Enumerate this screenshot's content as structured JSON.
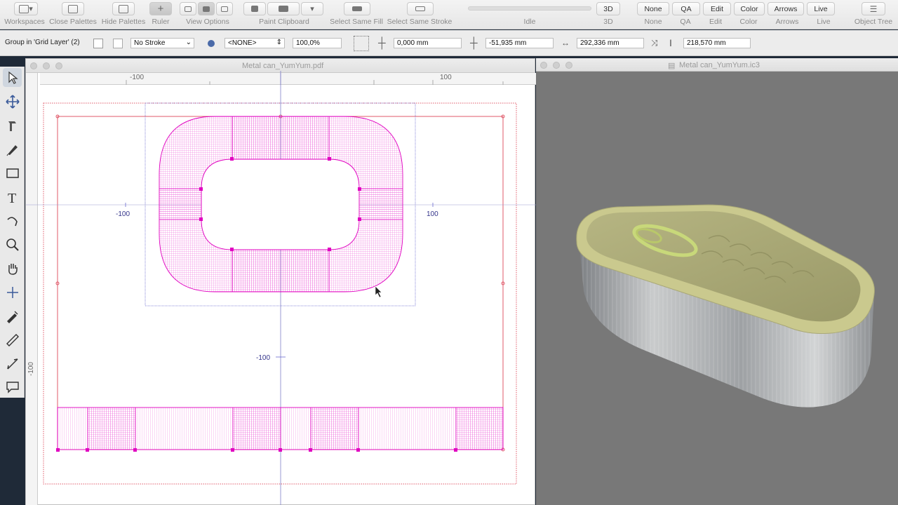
{
  "toolbar": {
    "workspaces": "Workspaces",
    "close_palettes": "Close Palettes",
    "hide_palettes": "Hide Palettes",
    "ruler": "Ruler",
    "view_options": "View Options",
    "paint_clipboard": "Paint Clipboard",
    "select_same_fill": "Select Same Fill",
    "select_same_stroke": "Select Same Stroke",
    "status": "Idle",
    "btn_3d": "3D",
    "label_3d": "3D",
    "btn_none": "None",
    "label_none": "None",
    "btn_qa": "QA",
    "label_qa": "QA",
    "btn_edit": "Edit",
    "label_edit": "Edit",
    "btn_color": "Color",
    "label_color": "Color",
    "btn_arrows": "Arrows",
    "label_arrows": "Arrows",
    "btn_live": "Live",
    "label_live": "Live",
    "object_tree": "Object Tree"
  },
  "properties": {
    "selection": "Group in 'Grid Layer' (2)",
    "stroke": "No Stroke",
    "style": "<NONE>",
    "opacity": "100,0%",
    "x": "0,000 mm",
    "y": "-51,935 mm",
    "width": "292,336 mm",
    "height": "218,570 mm"
  },
  "document": {
    "title": "Metal can_YumYum.pdf",
    "ruler_top": [
      "-100",
      "100"
    ],
    "ruler_left": [
      "-100"
    ],
    "axis_labels": {
      "x_neg": "-100",
      "x_pos": "100",
      "y_neg": "-100"
    }
  },
  "viewer3d": {
    "title": "Metal can_YumYum.ic3"
  },
  "colors": {
    "accent": "#e000c0",
    "guide": "#6a6ad0",
    "frame": "#e05a6a",
    "lid": "#b7b47a",
    "viewport": "#787878"
  }
}
